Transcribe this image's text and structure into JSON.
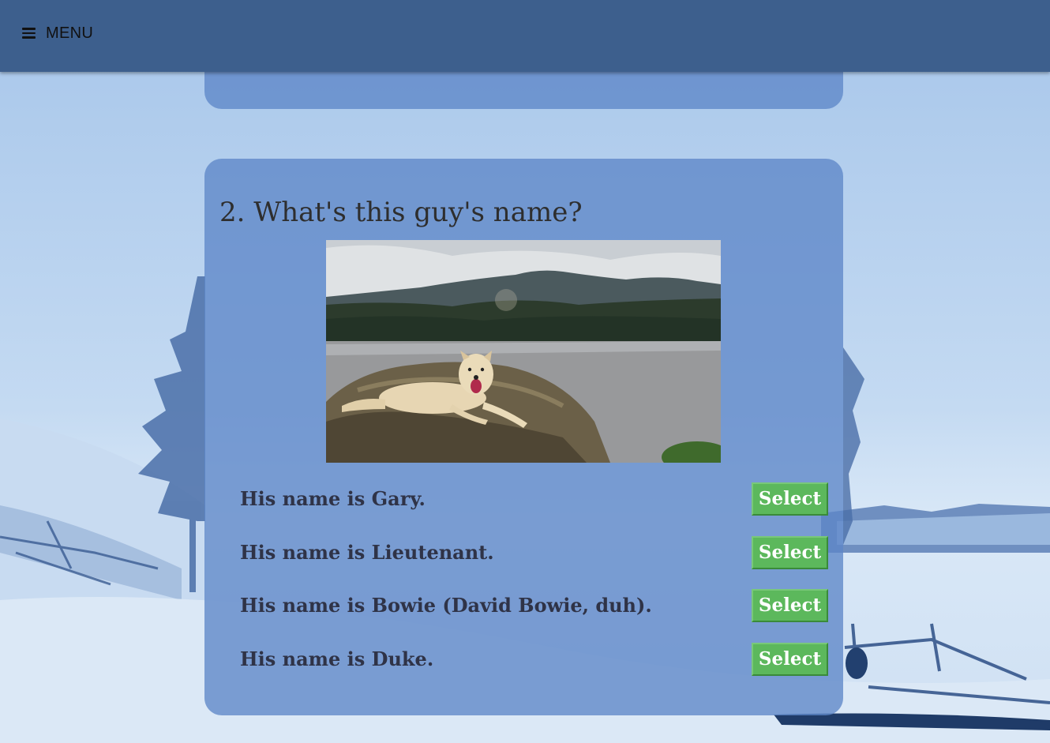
{
  "nav": {
    "menu_label": "MENU",
    "menu_icon": "hamburger-icon"
  },
  "question": {
    "title": "2. What's this guy's name?",
    "image_subject": "dog lying on a rock by a lake with mountains",
    "answers": [
      {
        "text": "His name is Gary.",
        "button": "Select"
      },
      {
        "text": "His name is Lieutenant.",
        "button": "Select"
      },
      {
        "text": "His name is Bowie (David Bowie, duh).",
        "button": "Select"
      },
      {
        "text": "His name is Duke.",
        "button": "Select"
      }
    ]
  },
  "colors": {
    "topbar": "#3d5f8d",
    "card": "#5d86c8",
    "select_button": "#5cb85c",
    "answer_text": "#2f3347"
  }
}
